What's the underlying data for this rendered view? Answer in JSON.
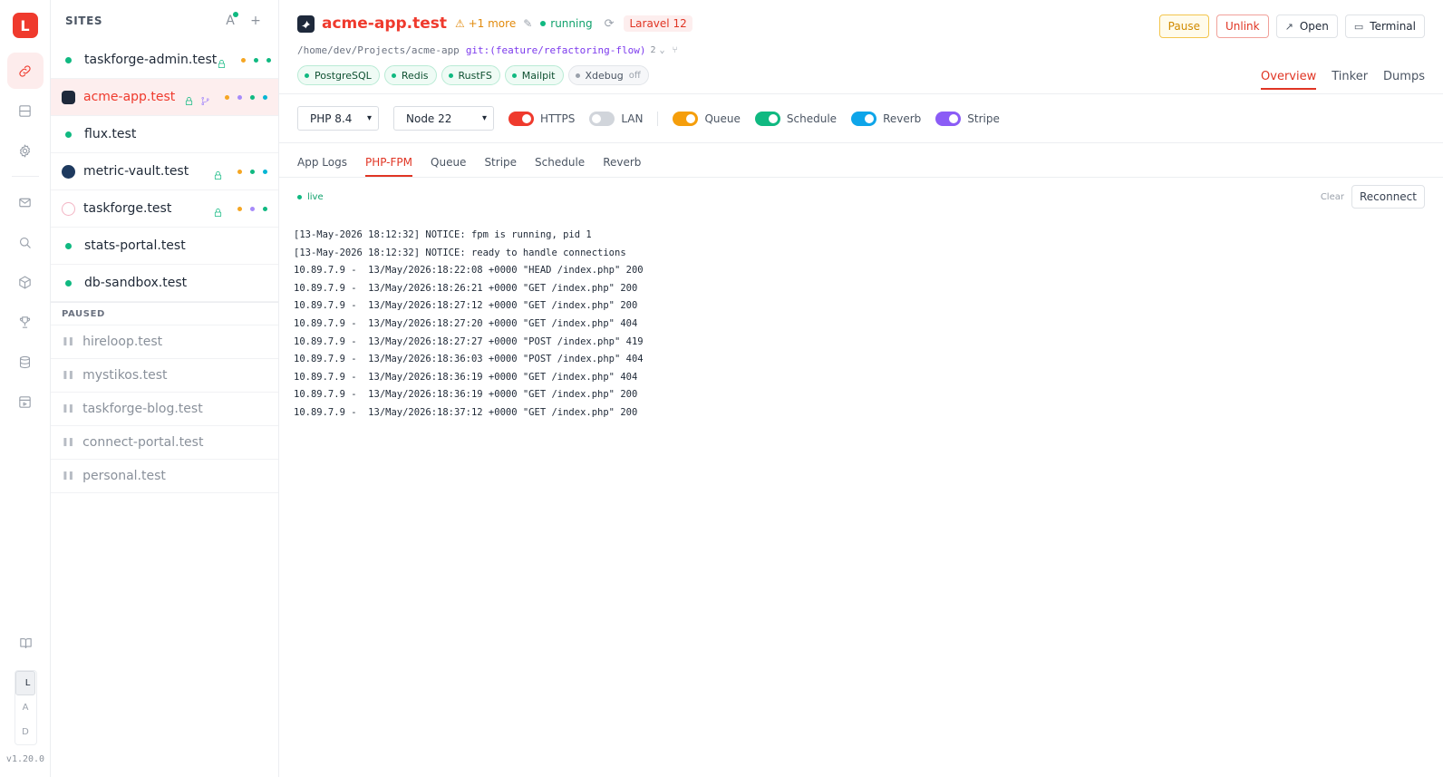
{
  "rail": {
    "logo": "L",
    "lad": [
      "L",
      "A",
      "D"
    ],
    "version": "v1.20.0"
  },
  "sites_panel": {
    "title": "SITES",
    "sort_icon": "A",
    "active": [
      {
        "name": "taskforge-admin.test",
        "lock": true,
        "git": false,
        "dots": [
          "#f5a623",
          "#10b981",
          "#10b981"
        ]
      },
      {
        "name": "acme-app.test",
        "lock": true,
        "git": true,
        "dots": [
          "#f5a623",
          "#a78bfa",
          "#10b981",
          "#06b6d4"
        ]
      },
      {
        "name": "flux.test",
        "lock": false,
        "git": false,
        "dots": []
      },
      {
        "name": "metric-vault.test",
        "lock": true,
        "git": false,
        "dots": [
          "#f5a623",
          "#10b981",
          "#06b6d4"
        ]
      },
      {
        "name": "taskforge.test",
        "lock": true,
        "git": false,
        "dots": [
          "#f5a623",
          "#a78bfa",
          "#10b981"
        ]
      },
      {
        "name": "stats-portal.test",
        "lock": false,
        "git": false,
        "dots": []
      },
      {
        "name": "db-sandbox.test",
        "lock": false,
        "git": false,
        "dots": []
      }
    ],
    "paused_label": "PAUSED",
    "paused": [
      "hireloop.test",
      "mystikos.test",
      "taskforge-blog.test",
      "connect-portal.test",
      "personal.test"
    ]
  },
  "project": {
    "title": "acme-app.test",
    "more": "+1 more",
    "status": "running",
    "framework": "Laravel 12",
    "path": "/home/dev/Projects/acme-app",
    "branch": "git:(feature/refactoring-flow)",
    "branch_count": "2",
    "services": [
      {
        "label": "PostgreSQL",
        "on": true
      },
      {
        "label": "Redis",
        "on": true
      },
      {
        "label": "RustFS",
        "on": true
      },
      {
        "label": "Mailpit",
        "on": true
      },
      {
        "label": "Xdebug",
        "on": false,
        "state": "off"
      }
    ]
  },
  "actions": {
    "pause": "Pause",
    "unlink": "Unlink",
    "open": "Open",
    "terminal": "Terminal"
  },
  "view_tabs": [
    "Overview",
    "Tinker",
    "Dumps"
  ],
  "toolbar": {
    "php": "PHP 8.4",
    "node": "Node 22",
    "toggles": [
      {
        "label": "HTTPS",
        "on": true,
        "color": "#ef3a2d"
      },
      {
        "label": "LAN",
        "on": false,
        "color": "#d1d5db"
      },
      {
        "label": "Queue",
        "on": true,
        "color": "#f59e0b"
      },
      {
        "label": "Schedule",
        "on": true,
        "color": "#10b981"
      },
      {
        "label": "Reverb",
        "on": true,
        "color": "#0ea5e9"
      },
      {
        "label": "Stripe",
        "on": true,
        "color": "#8b5cf6"
      }
    ]
  },
  "log_tabs": [
    "App Logs",
    "PHP-FPM",
    "Queue",
    "Stripe",
    "Schedule",
    "Reverb"
  ],
  "log": {
    "live": "live",
    "clear": "Clear",
    "reconnect": "Reconnect",
    "lines": [
      "[13-May-2026 18:12:32] NOTICE: fpm is running, pid 1",
      "[13-May-2026 18:12:32] NOTICE: ready to handle connections",
      "10.89.7.9 -  13/May/2026:18:22:08 +0000 \"HEAD /index.php\" 200",
      "10.89.7.9 -  13/May/2026:18:26:21 +0000 \"GET /index.php\" 200",
      "10.89.7.9 -  13/May/2026:18:27:12 +0000 \"GET /index.php\" 200",
      "10.89.7.9 -  13/May/2026:18:27:20 +0000 \"GET /index.php\" 404",
      "10.89.7.9 -  13/May/2026:18:27:27 +0000 \"POST /index.php\" 419",
      "10.89.7.9 -  13/May/2026:18:36:03 +0000 \"POST /index.php\" 404",
      "10.89.7.9 -  13/May/2026:18:36:19 +0000 \"GET /index.php\" 404",
      "10.89.7.9 -  13/May/2026:18:36:19 +0000 \"GET /index.php\" 200",
      "10.89.7.9 -  13/May/2026:18:37:12 +0000 \"GET /index.php\" 200"
    ]
  },
  "colors": {
    "accent": "#ef3a2d",
    "running": "#10b981",
    "warning": "#f5a623"
  }
}
